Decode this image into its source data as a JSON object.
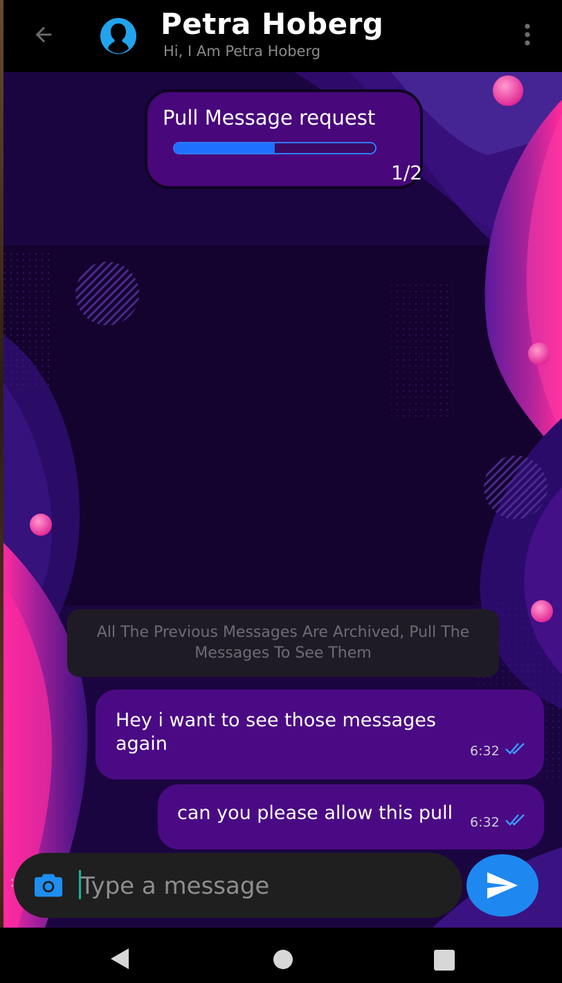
{
  "header": {
    "contact_name": "Petra Hoberg",
    "status": "Hi, I Am Petra Hoberg",
    "icons": {
      "back": "arrow-left-icon",
      "avatar": "person-silhouette-icon",
      "menu": "more-vertical-icon"
    }
  },
  "pull_request": {
    "title": "Pull Message request",
    "progress_label": "1/2",
    "progress_fraction": 0.5
  },
  "notice": {
    "text": "All The Previous Messages Are Archived, Pull The Messages To See Them"
  },
  "messages": [
    {
      "text": "Hey i want to see those messages again",
      "time": "6:32",
      "status": "read"
    },
    {
      "text": "can you please allow this pull",
      "time": "6:32",
      "status": "read"
    }
  ],
  "composer": {
    "placeholder": "Type a message",
    "value": "",
    "icons": {
      "camera": "camera-icon",
      "send": "send-icon"
    }
  },
  "colors": {
    "accent": "#1e88f0",
    "bubble": "#4a0a84",
    "progress": "#1e72ff"
  },
  "navbar": {
    "icons": [
      "nav-back-icon",
      "nav-home-icon",
      "nav-recents-icon"
    ]
  }
}
